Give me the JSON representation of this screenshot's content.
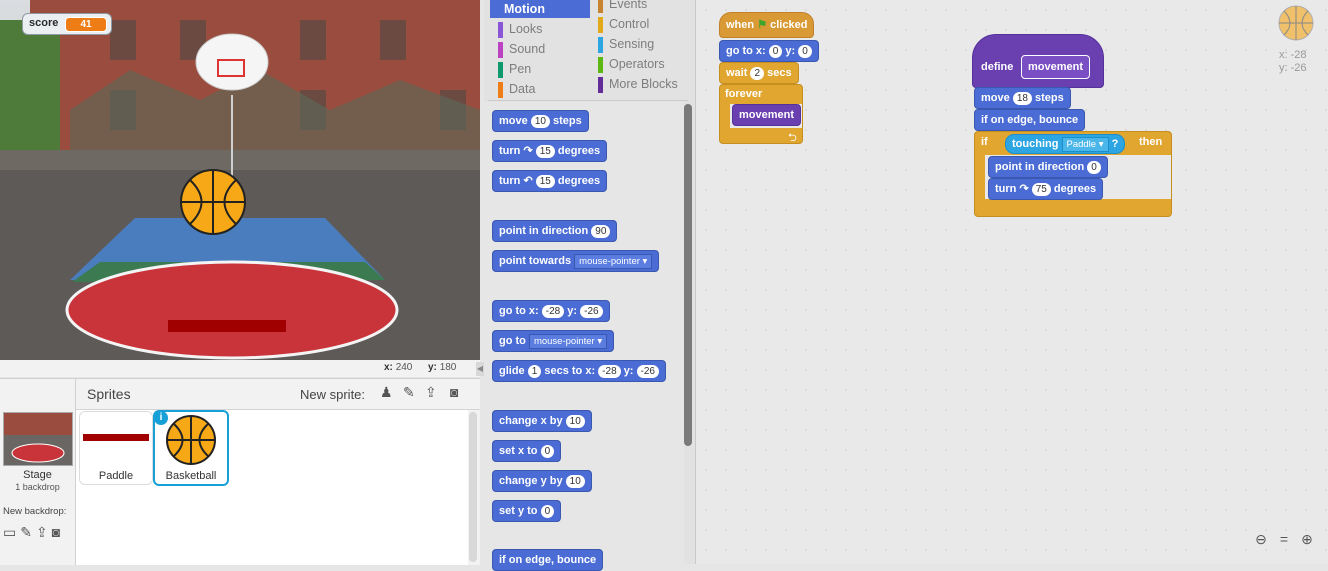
{
  "stage": {
    "variable": {
      "label": "score",
      "value": "41"
    },
    "mouse_x_label": "x:",
    "mouse_x": "240",
    "mouse_y_label": "y:",
    "mouse_y": "180"
  },
  "sprites": {
    "header": "Sprites",
    "new_sprite_label": "New sprite:",
    "stage_name": "Stage",
    "stage_backdrops": "1 backdrop",
    "new_backdrop_label": "New backdrop:",
    "items": [
      {
        "name": "Paddle"
      },
      {
        "name": "Basketball"
      }
    ]
  },
  "palette": {
    "categories_left": [
      {
        "label": "Motion",
        "color": "#4a6cd4"
      },
      {
        "label": "Looks",
        "color": "#8a55d7"
      },
      {
        "label": "Sound",
        "color": "#bb42c3"
      },
      {
        "label": "Pen",
        "color": "#0e9a6c"
      },
      {
        "label": "Data",
        "color": "#ee7d16"
      }
    ],
    "categories_right": [
      {
        "label": "Events",
        "color": "#c88330"
      },
      {
        "label": "Control",
        "color": "#e1a91a"
      },
      {
        "label": "Sensing",
        "color": "#2ca5e2"
      },
      {
        "label": "Operators",
        "color": "#5cb712"
      },
      {
        "label": "More Blocks",
        "color": "#632d99"
      }
    ],
    "blocks": {
      "move": "move",
      "move_steps": "10",
      "steps": "steps",
      "turn": "turn",
      "turn_cw_deg": "15",
      "degrees": "degrees",
      "turn_ccw_deg": "15",
      "point_in_direction": "point in direction",
      "direction": "90",
      "point_towards": "point towards",
      "towards_target": "mouse-pointer",
      "go_to_x": "go to x:",
      "goto_x": "-28",
      "y": "y:",
      "goto_y": "-26",
      "go_to": "go to",
      "goto_target": "mouse-pointer",
      "glide": "glide",
      "glide_secs": "1",
      "secs_to_x": "secs to x:",
      "glide_x": "-28",
      "glide_y": "-26",
      "change_x_by": "change x by",
      "change_x": "10",
      "set_x_to": "set x to",
      "set_x": "0",
      "change_y_by": "change y by",
      "change_y": "10",
      "set_y_to": "set y to",
      "set_y": "0",
      "if_on_edge": "if on edge, bounce"
    }
  },
  "scripts": {
    "when": "when",
    "clicked": "clicked",
    "go_to_x": "go to x:",
    "x": "0",
    "y_label": "y:",
    "y": "0",
    "wait": "wait",
    "wait_secs": "2",
    "secs": "secs",
    "forever": "forever",
    "movement": "movement",
    "define": "define",
    "define_name": "movement",
    "move": "move",
    "move_steps": "18",
    "steps": "steps",
    "if_on_edge": "if on edge, bounce",
    "if": "if",
    "touching": "touching",
    "touching_target": "Paddle",
    "q": "?",
    "then": "then",
    "point_in_direction": "point in direction",
    "direction": "0",
    "turn": "turn",
    "turn_deg": "75",
    "degrees": "degrees",
    "sprite_x_label": "x:",
    "sprite_x": "-28",
    "sprite_y_label": "y:",
    "sprite_y": "-26"
  }
}
